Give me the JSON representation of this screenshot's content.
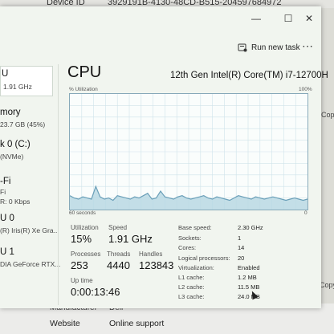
{
  "background": {
    "device_id_label": "Device ID",
    "device_id_value": "3929191B-4130-48CD-B515-204597684972",
    "manufacturer_label": "Manufacturer",
    "manufacturer_value": "Dell",
    "website_label": "Website",
    "website_value": "Online support",
    "copy_label": "Copy",
    "copy_label_2": "Copy"
  },
  "window": {
    "minimize": "—",
    "maximize": "☐",
    "close": "✕",
    "run_new_task": "Run new task",
    "more": "⋯"
  },
  "sidebar": [
    {
      "line1": "U",
      "line2": "1.91 GHz"
    },
    {
      "line1": "mory",
      "line2": "23.7 GB (45%)"
    },
    {
      "line1": "k 0 (C:)",
      "line2": "(NVMe)"
    },
    {
      "line1": "-Fi",
      "line2": "Fi",
      "line3": "R: 0 Kbps"
    },
    {
      "line1": "U 0",
      "line2": "(R) Iris(R) Xe Gra..."
    },
    {
      "line1": "U 1",
      "line2": "DIA GeForce RTX..."
    }
  ],
  "cpu": {
    "title": "CPU",
    "model": "12th Gen Intel(R) Core(TM) i7-12700H",
    "util_label": "% Utilization",
    "max_label": "100%",
    "axis_left": "60 seconds",
    "axis_right": "0",
    "graph_values": [
      12,
      10,
      9,
      11,
      10,
      9,
      20,
      11,
      9,
      10,
      8,
      12,
      11,
      10,
      9,
      11,
      10,
      12,
      14,
      9,
      10,
      16,
      11,
      10,
      9,
      11,
      12,
      10,
      9,
      10,
      11,
      12,
      10,
      9,
      11,
      10,
      9,
      8,
      10,
      12,
      11,
      10,
      9,
      11,
      10,
      9,
      10,
      11,
      10,
      9,
      8,
      9,
      10,
      9,
      8,
      9
    ]
  },
  "stats": {
    "utilization_label": "Utilization",
    "utilization_value": "15%",
    "speed_label": "Speed",
    "speed_value": "1.91 GHz",
    "processes_label": "Processes",
    "processes_value": "253",
    "threads_label": "Threads",
    "threads_value": "4440",
    "handles_label": "Handles",
    "handles_value": "123843",
    "uptime_label": "Up time",
    "uptime_value": "0:00:13:46"
  },
  "specs": [
    {
      "label": "Base speed:",
      "value": "2.30 GHz"
    },
    {
      "label": "Sockets:",
      "value": "1"
    },
    {
      "label": "Cores:",
      "value": "14"
    },
    {
      "label": "Logical processors:",
      "value": "20"
    },
    {
      "label": "Virtualization:",
      "value": "Enabled"
    },
    {
      "label": "L1 cache:",
      "value": "1.2 MB"
    },
    {
      "label": "L2 cache:",
      "value": "11.5 MB"
    },
    {
      "label": "L3 cache:",
      "value": "24.0 MB"
    }
  ],
  "colors": {
    "graph_line": "#6a9fb8",
    "graph_fill": "#b9d8e3",
    "grid": "#cfe3ea"
  }
}
